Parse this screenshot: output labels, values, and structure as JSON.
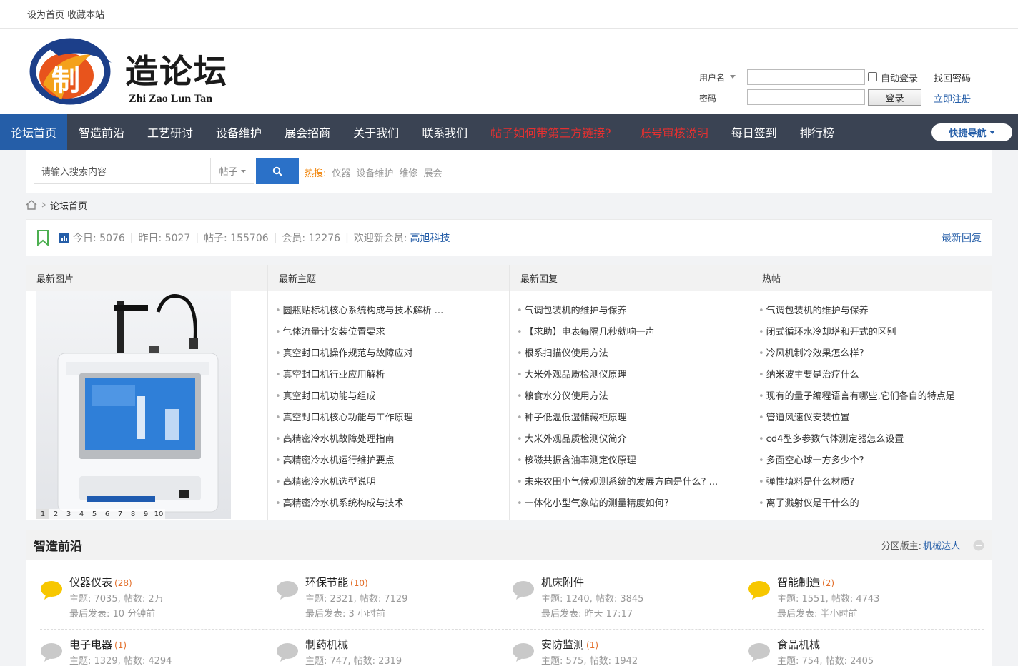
{
  "topbar": {
    "set_home": "设为首页",
    "bookmark": "收藏本站"
  },
  "logo": {
    "title": "造论坛",
    "subtitle": "Zhi Zao Lun Tan"
  },
  "login": {
    "username_label": "用户名",
    "password_label": "密码",
    "username_value": "",
    "password_value": "",
    "auto_login": "自动登录",
    "login_button": "登录",
    "find_password": "找回密码",
    "register": "立即注册"
  },
  "nav": {
    "items": [
      {
        "label": "论坛首页"
      },
      {
        "label": "智造前沿"
      },
      {
        "label": "工艺研讨"
      },
      {
        "label": "设备维护"
      },
      {
        "label": "展会招商"
      },
      {
        "label": "关于我们"
      },
      {
        "label": "联系我们"
      },
      {
        "label": "帖子如何带第三方链接?"
      },
      {
        "label": "账号审核说明"
      },
      {
        "label": "每日签到"
      },
      {
        "label": "排行榜"
      }
    ],
    "quick_nav": "快捷导航"
  },
  "search": {
    "placeholder": "请输入搜索内容",
    "type": "帖子",
    "hot_label": "热搜:",
    "hot_terms": [
      "仪器",
      "设备维护",
      "维修",
      "展会"
    ]
  },
  "breadcrumb": {
    "current": "论坛首页"
  },
  "stats": {
    "today": "今日: 5076",
    "yesterday": "昨日: 5027",
    "posts": "帖子: 155706",
    "members": "会员: 12276",
    "welcome": "欢迎新会员:",
    "new_member": "高旭科技",
    "latest_reply": "最新回复"
  },
  "panel": {
    "images_title": "最新图片",
    "pages": [
      "1",
      "2",
      "3",
      "4",
      "5",
      "6",
      "7",
      "8",
      "9",
      "10"
    ],
    "topics_title": "最新主题",
    "topics": [
      "圆瓶贴标机核心系统构成与技术解析 ...",
      "气体流量计安装位置要求",
      "真空封口机操作规范与故障应对",
      "真空封口机行业应用解析",
      "真空封口机功能与组成",
      "真空封口机核心功能与工作原理",
      "高精密冷水机故障处理指南",
      "高精密冷水机运行维护要点",
      "高精密冷水机选型说明",
      "高精密冷水机系统构成与技术"
    ],
    "replies_title": "最新回复",
    "replies": [
      "气调包装机的维护与保养",
      "【求助】电表每隔几秒就响一声",
      "根系扫描仪使用方法",
      "大米外观品质检测仪原理",
      "粮食水分仪使用方法",
      "种子低温低湿储藏柜原理",
      "大米外观品质检测仪简介",
      "核磁共振含油率测定仪原理",
      "未来农田小气候观测系统的发展方向是什么? ...",
      "一体化小型气象站的测量精度如何?"
    ],
    "hot_title": "热帖",
    "hot": [
      "气调包装机的维护与保养",
      "闭式循环水冷却塔和开式的区别",
      "冷风机制冷效果怎么样?",
      "纳米波主要是治疗什么",
      "现有的量子编程语言有哪些,它们各自的特点是",
      "管道风速仪安装位置",
      "cd4型多参数气体测定器怎么设置",
      "多面空心球一方多少个?",
      "弹性填料是什么材质?",
      "离子溅射仪是干什么的"
    ]
  },
  "forum": {
    "title": "智造前沿",
    "moderator_label": "分区版主:",
    "moderator": "机械达人",
    "boards": [
      {
        "name": "仪器仪表",
        "count": "(28)",
        "stats": "主题: 7035, 帖数: 2万",
        "last": "最后发表: 10 分钟前",
        "active": true
      },
      {
        "name": "环保节能",
        "count": "(10)",
        "stats": "主题: 2321, 帖数: 7129",
        "last": "最后发表: 3 小时前",
        "active": false
      },
      {
        "name": "机床附件",
        "count": "",
        "stats": "主题: 1240, 帖数: 3845",
        "last": "最后发表: 昨天 17:17",
        "active": false
      },
      {
        "name": "智能制造",
        "count": "(2)",
        "stats": "主题: 1551, 帖数: 4743",
        "last": "最后发表: 半小时前",
        "active": true
      },
      {
        "name": "电子电器",
        "count": "(1)",
        "stats": "主题: 1329, 帖数: 4294",
        "last": "",
        "active": false
      },
      {
        "name": "制药机械",
        "count": "",
        "stats": "主题: 747, 帖数: 2319",
        "last": "",
        "active": false
      },
      {
        "name": "安防监测",
        "count": "(1)",
        "stats": "主题: 575, 帖数: 1942",
        "last": "",
        "active": false
      },
      {
        "name": "食品机械",
        "count": "",
        "stats": "主题: 754, 帖数: 2405",
        "last": "",
        "active": false
      }
    ]
  },
  "colors": {
    "nav_bg": "#3a4353",
    "nav_active": "#255ea8",
    "accent_blue": "#2b71c8",
    "hot_orange": "#f08000",
    "bubble_active": "#f7c700",
    "bubble_idle": "#c9c9c9"
  }
}
